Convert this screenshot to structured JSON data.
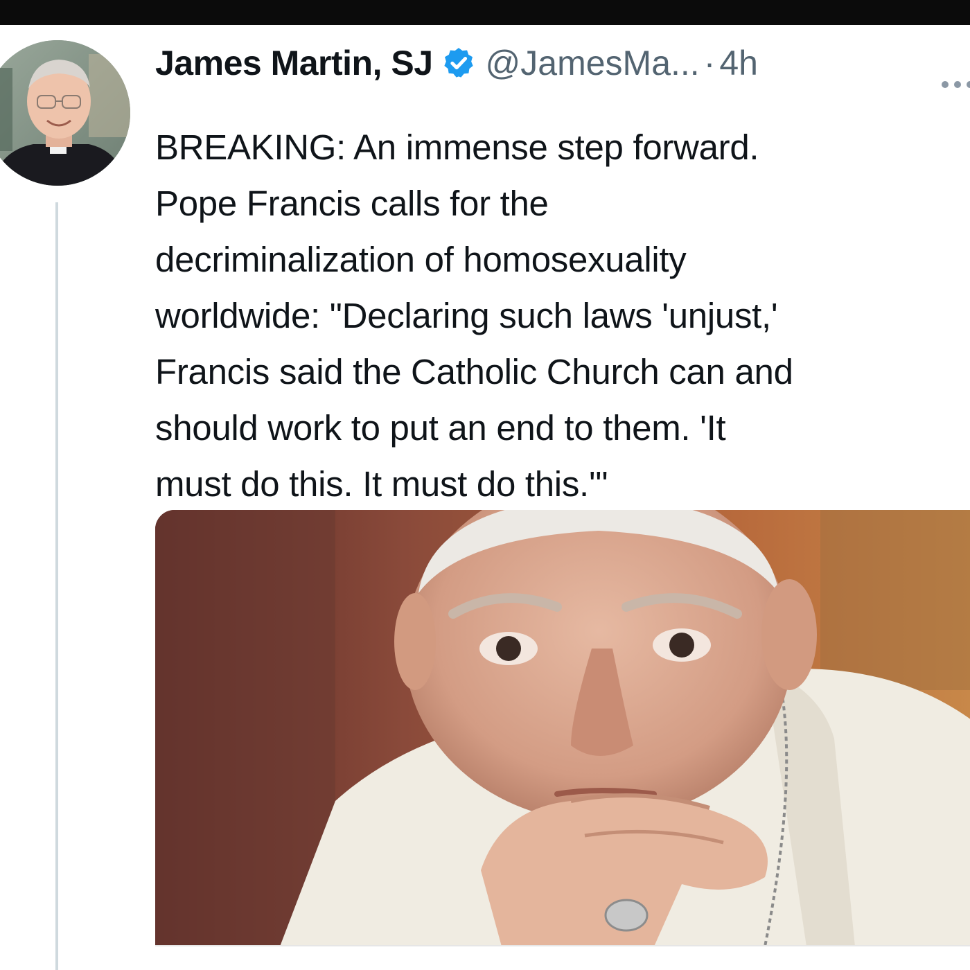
{
  "tweet": {
    "author_name": "James Martin, SJ",
    "handle": "@JamesMa...",
    "separator": "·",
    "time": "4h",
    "text": "BREAKING: An immense step forward.\nPope Francis calls for the\ndecriminalization of homosexuality\nworldwide: \"Declaring such laws 'unjust,'\nFrancis said the Catholic Church can and\nshould work to put an end to them. 'It\nmust do this. It must do this.'\""
  },
  "icons": {
    "verified": "verified-badge-icon",
    "more": "more-options-icon"
  },
  "colors": {
    "verified_blue": "#1d9bf0",
    "secondary_text": "#536471",
    "primary_text": "#0f1419"
  }
}
